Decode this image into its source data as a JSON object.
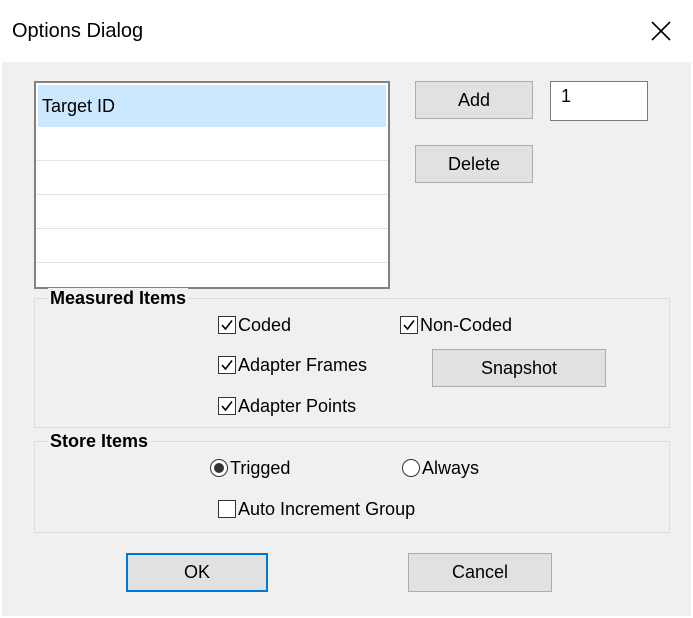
{
  "window": {
    "title": "Options Dialog"
  },
  "target_list": {
    "items": [
      "Target ID",
      "",
      "",
      "",
      ""
    ],
    "selected_index": 0
  },
  "buttons": {
    "add": "Add",
    "delete": "Delete",
    "snapshot": "Snapshot",
    "ok": "OK",
    "cancel": "Cancel"
  },
  "count_field": {
    "value": "1"
  },
  "measured_items": {
    "label": "Measured Items",
    "coded": {
      "label": "Coded",
      "checked": true
    },
    "non_coded": {
      "label": "Non-Coded",
      "checked": true
    },
    "adapter_frames": {
      "label": "Adapter Frames",
      "checked": true
    },
    "adapter_points": {
      "label": "Adapter Points",
      "checked": true
    }
  },
  "store_items": {
    "label": "Store Items",
    "trigged": {
      "label": "Trigged",
      "selected": true
    },
    "always": {
      "label": "Always",
      "selected": false
    },
    "auto_increment": {
      "label": "Auto Increment Group",
      "checked": false
    }
  },
  "colors": {
    "dialog_bg": "#f0f0f0",
    "selection": "#cce8ff",
    "default_button_border": "#0078d7",
    "button_bg": "#e1e1e1"
  }
}
